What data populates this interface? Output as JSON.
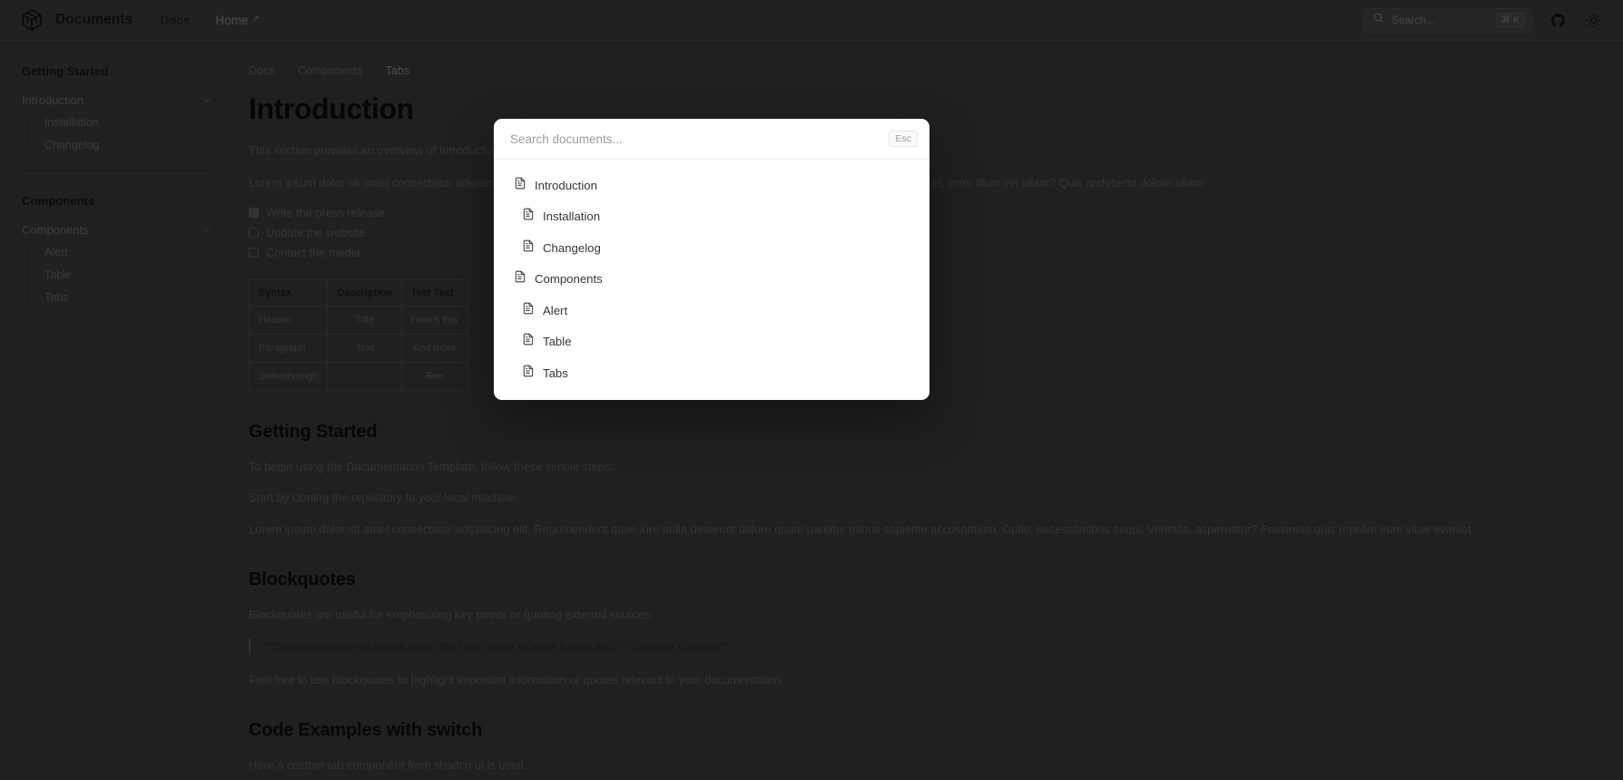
{
  "topbar": {
    "logo_icon": "cube-logo-icon",
    "brand": "Documents",
    "links": [
      {
        "label": "Docs",
        "external": false
      },
      {
        "label": "Home",
        "external": true,
        "arrow": "↗"
      }
    ],
    "search": {
      "icon": "search-icon",
      "placeholder": "Search...",
      "shortcut": "⌘ K"
    },
    "github_icon": "github-icon",
    "theme_icon": "sun-theme-icon"
  },
  "sidebar": {
    "groups": [
      {
        "title": "Getting Started",
        "parent": {
          "label": "Introduction",
          "chevron": "chevron-down-icon"
        },
        "children": [
          {
            "label": "Installation"
          },
          {
            "label": "Changelog"
          }
        ]
      },
      {
        "title": "Components",
        "parent": {
          "label": "Components",
          "chevron": "chevron-down-icon"
        },
        "children": [
          {
            "label": "Alert"
          },
          {
            "label": "Table"
          },
          {
            "label": "Tabs"
          }
        ]
      }
    ]
  },
  "main": {
    "breadcrumb": [
      "Docs",
      "Components",
      "Tabs"
    ],
    "breadcrumb_separator": "›",
    "page_title": "Introduction",
    "intro_paragraph": "This section provides an overview of Introduction.",
    "lorem_paragraph": "Lorem ipsum dolor sit amet consectetur adipisicing elit. Nulla dolore voluptate sapiente aut ipsa, aspernatur reiciendis facilis aperiam et, error illum vel ullam? Quis architecto dolore ullam",
    "checklist": [
      {
        "label": "Write the press release",
        "checked": true
      },
      {
        "label": "Update the website",
        "checked": false
      },
      {
        "label": "Contact the media",
        "checked": false
      }
    ],
    "table": {
      "headers": [
        "Syntax",
        "Description",
        "Test Text"
      ],
      "rows": [
        {
          "syntax": "Header",
          "description": "Title",
          "test_text": "Here's this",
          "strike": false
        },
        {
          "syntax": "Paragraph",
          "description": "Text",
          "test_text": "And more",
          "strike": false
        },
        {
          "syntax": "Strikethrough",
          "description": "",
          "test_text": "Text",
          "strike": true
        }
      ]
    },
    "getting_started": {
      "title": "Getting Started",
      "p1": "To begin using the Documentation Template, follow these simple steps:",
      "p2": "Start by cloning the repository to your local machine.",
      "p3": "Lorem ipsum dolor sit amet consectetur adipisicing elit. Reprehenderit quae iure nulla deserunt dolore quam pariatur minus sapiente accusantium. Optio, necessitatibus sequi. Veritatis, aspernatur? Possimus quis repellat eum vitae eveniet."
    },
    "blockquotes": {
      "title": "Blockquotes",
      "p1": "Blockquotes are useful for emphasizing key points or quoting external sources:",
      "quote": "\"\"Documentation is a love letter that you write to your future self.\" - Damian Conway\"",
      "p2": "Feel free to use blockquotes to highlight important information or quotes relevant to your documentation."
    },
    "code_examples": {
      "title": "Code Examples with switch",
      "p1": "Here a custom tab component from shadcn ui is used."
    }
  },
  "command_dialog": {
    "placeholder": "Search documents...",
    "value": "",
    "esc_label": "Esc",
    "items": [
      {
        "label": "Introduction",
        "icon": "document-icon",
        "indent": false
      },
      {
        "label": "Installation",
        "icon": "document-icon",
        "indent": true
      },
      {
        "label": "Changelog",
        "icon": "document-icon",
        "indent": true
      },
      {
        "label": "Components",
        "icon": "document-icon",
        "indent": false
      },
      {
        "label": "Alert",
        "icon": "document-icon",
        "indent": true
      },
      {
        "label": "Table",
        "icon": "document-icon",
        "indent": true
      },
      {
        "label": "Tabs",
        "icon": "document-icon",
        "indent": true
      }
    ]
  },
  "colors": {
    "page_background": "#2e2e2e",
    "topbar_background": "#303030",
    "dialog_background": "#ffffff",
    "overlay": "rgba(0,0,0,0.30)"
  }
}
